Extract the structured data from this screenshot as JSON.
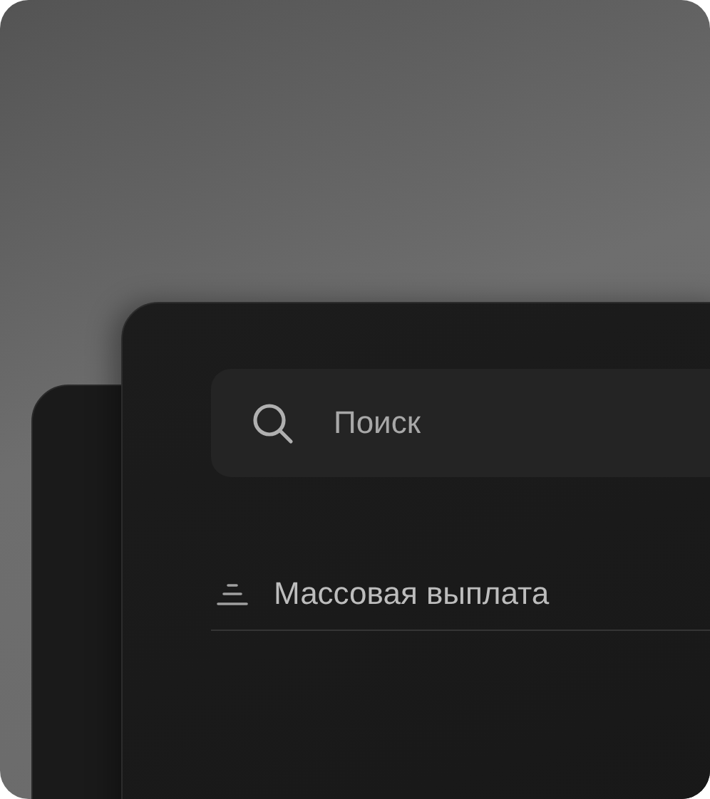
{
  "search": {
    "placeholder": "Поиск"
  },
  "menu_items": [
    {
      "label": "Массовая выплата"
    }
  ]
}
